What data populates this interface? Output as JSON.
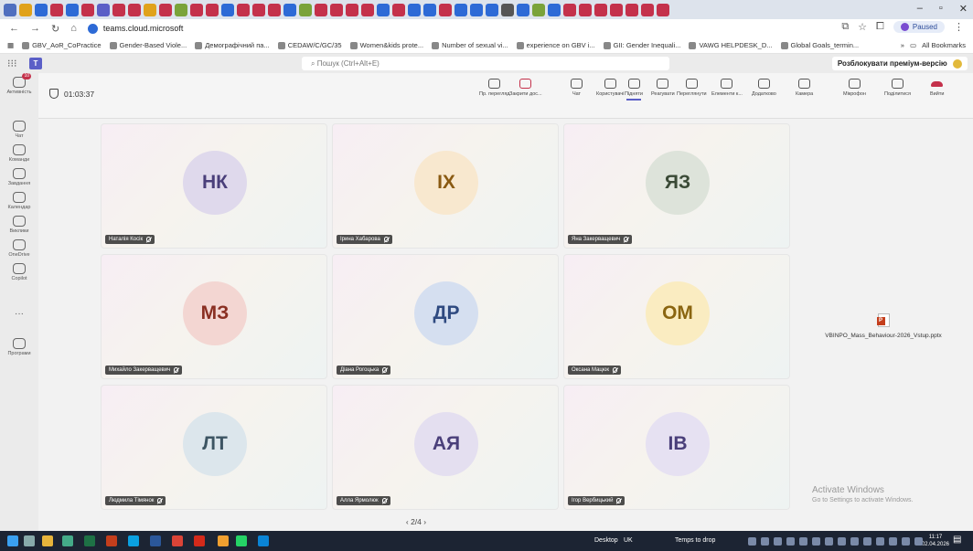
{
  "browser": {
    "url": "teams.cloud.microsoft",
    "profile_status": "Paused",
    "all_bookmarks_label": "All Bookmarks",
    "bookmarks": [
      "GBV_AoR_CoPractice",
      "Gender-Based Viole...",
      "Демографічний па...",
      "CEDAW/C/GC/35",
      "Women&kids prote...",
      "Number of sexual vi...",
      "experience on GBV i...",
      "GII: Gender Inequali...",
      "VAWG HELPDESK_D...",
      "Global Goals_termin..."
    ]
  },
  "teams": {
    "search_placeholder": "Пошук (Ctrl+Alt+E)",
    "premium_label": "Розблокувати преміум-версію"
  },
  "rail": [
    {
      "label": "Активність",
      "icon": "bell-icon"
    },
    {
      "label": "Чат",
      "icon": "chat-icon"
    },
    {
      "label": "Команди",
      "icon": "teams-icon"
    },
    {
      "label": "Завдання",
      "icon": "tasks-icon"
    },
    {
      "label": "Календар",
      "icon": "calendar-icon"
    },
    {
      "label": "Виклики",
      "icon": "phone-icon"
    },
    {
      "label": "OneDrive",
      "icon": "cloud-icon"
    },
    {
      "label": "Copilot",
      "icon": "copilot-icon"
    },
    {
      "label": "Програми",
      "icon": "apps-icon"
    }
  ],
  "meeting": {
    "timer": "01:03:37",
    "tools": [
      {
        "label": "Пр. перегляд",
        "icon": "preview-icon"
      },
      {
        "label": "Закрити дос...",
        "icon": "close-share-icon"
      },
      {
        "label": "Чат",
        "icon": "chat-icon"
      },
      {
        "label": "Користувачі",
        "icon": "people-icon"
      },
      {
        "label": "Підняти",
        "icon": "raise-hand-icon"
      },
      {
        "label": "Реагувати",
        "icon": "react-icon"
      },
      {
        "label": "Переглянути",
        "icon": "view-icon"
      },
      {
        "label": "Елементи к...",
        "icon": "elements-icon"
      },
      {
        "label": "Додатково",
        "icon": "more-icon"
      },
      {
        "label": "Камера",
        "icon": "camera-off-icon"
      },
      {
        "label": "Мікрофон",
        "icon": "mic-off-icon"
      },
      {
        "label": "Поділитися",
        "icon": "share-icon"
      },
      {
        "label": "Вийти",
        "icon": "leave-icon"
      }
    ],
    "participants": [
      {
        "initials": "НК",
        "name": "Наталія Косік",
        "bg": "#dfd9ec",
        "fg": "#4a3f7a"
      },
      {
        "initials": "ІХ",
        "name": "Ірина Хабарова",
        "bg": "#f8e8cf",
        "fg": "#8a5a12"
      },
      {
        "initials": "ЯЗ",
        "name": "Яна Закерващевич",
        "bg": "#dde3da",
        "fg": "#3a4a36"
      },
      {
        "initials": "МЗ",
        "name": "Михайло Закерващевич",
        "bg": "#f3d6d2",
        "fg": "#8a2f22"
      },
      {
        "initials": "ДР",
        "name": "Діана Рогоцька",
        "bg": "#d5dff0",
        "fg": "#2f4a80"
      },
      {
        "initials": "ОМ",
        "name": "Оксана Мацюк",
        "bg": "#faecc1",
        "fg": "#8a6510"
      },
      {
        "initials": "ЛТ",
        "name": "Людмила Тімянок",
        "bg": "#dce6ec",
        "fg": "#3d5563"
      },
      {
        "initials": "АЯ",
        "name": "Алла Ярмолюк",
        "bg": "#e4dff0",
        "fg": "#4a3f7a"
      },
      {
        "initials": "ІВ",
        "name": "Ігор Вербицький",
        "bg": "#e6e1f2",
        "fg": "#4a3f7a"
      }
    ],
    "pager": "2/4"
  },
  "shared_file": "VBINPO_Mass_Behaviour-2026_Vstup.pptx",
  "watermark": {
    "line1": "Activate Windows",
    "line2": "Go to Settings to activate Windows."
  },
  "taskbar": {
    "desktop_label": "Desktop",
    "lang": "UK",
    "temps_label": "Temps to drop",
    "time": "11:17",
    "date": "02.04.2026"
  }
}
